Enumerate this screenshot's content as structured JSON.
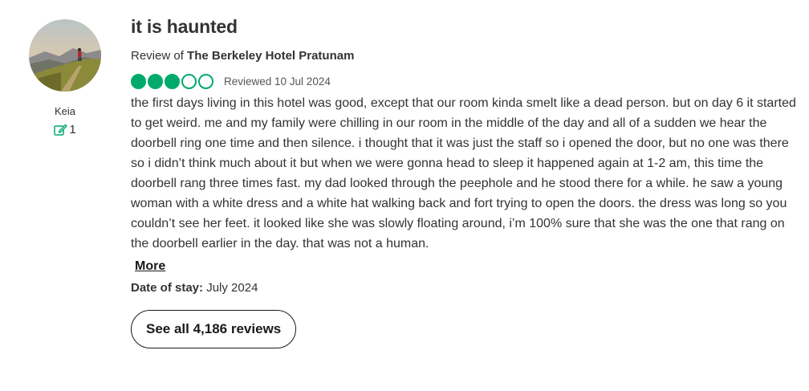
{
  "reviewer": {
    "name": "Keia",
    "contributions": "1",
    "avatar_icon": "mountain-hiker-photo",
    "contrib_icon": "edit-icon"
  },
  "review": {
    "title": "it is haunted",
    "review_of_prefix": "Review of",
    "hotel_name": "The Berkeley Hotel Pratunam",
    "rating": 3,
    "rating_max": 5,
    "bubble_color": "#00aa6c",
    "reviewed_date": "Reviewed 10 Jul 2024",
    "text": "the first days living in this hotel was good, except that our room kinda smelt like a dead person. but on day 6 it started to get weird. me and my family were chilling in our room in the middle of the day and all of a sudden we hear the doorbell ring one time and then silence. i thought that it was just the staff so i opened the door, but no one was there so i didn’t think much about it but when we were gonna head to sleep it happened again at 1-2 am, this time the doorbell rang three times fast. my dad looked through the peephole and he stood there for a while. he saw a young woman with a white dress and a white hat walking back and fort trying to open the doors. the dress was long so you couldn’t see her feet. it looked like she was slowly floating around, i’m 100% sure that she was the one that rang on the doorbell earlier in the day. that was not a human.",
    "more_label": "More",
    "date_of_stay_label": "Date of stay:",
    "date_of_stay_value": "July 2024"
  },
  "see_all_label": "See all 4,186 reviews"
}
